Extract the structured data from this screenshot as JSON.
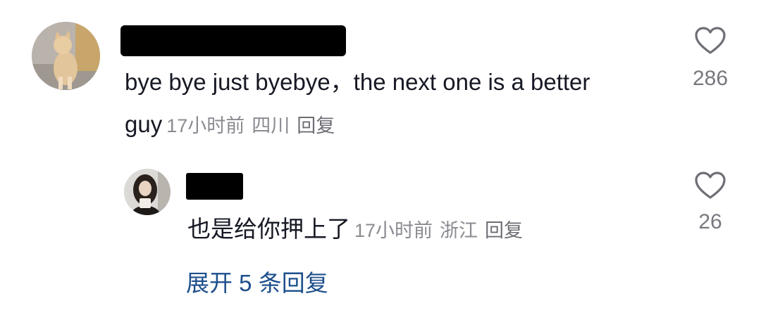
{
  "comment": {
    "text": "bye bye just byebye，the next one is a better guy",
    "time": "17小时前",
    "location": "四川",
    "reply_label": "回复",
    "like_count": "286"
  },
  "reply": {
    "text": "也是给你押上了",
    "time": "17小时前",
    "location": "浙江",
    "reply_label": "回复",
    "like_count": "26"
  },
  "expand_label": "展开 5 条回复",
  "icons": {
    "like": "heart-outline-icon"
  },
  "colors": {
    "text": "#161823",
    "meta": "#8a8b91",
    "link": "#1d4f8c"
  }
}
